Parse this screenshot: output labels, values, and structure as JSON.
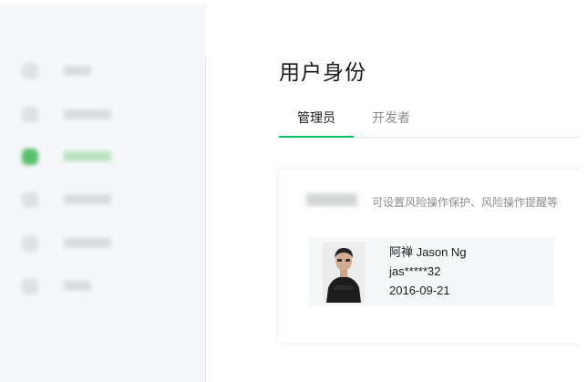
{
  "main": {
    "title": "用户身份",
    "tabs": [
      {
        "label": "管理员",
        "active": true
      },
      {
        "label": "开发者",
        "active": false
      }
    ],
    "description": "可设置风险操作保护、风险操作提醒等",
    "user": {
      "name": "阿禅 Jason Ng",
      "account": "jas*****32",
      "date": "2016-09-21"
    }
  },
  "sidebar": {
    "item_count": 6,
    "active_index": 2
  },
  "colors": {
    "accent": "#07c160",
    "sidebar_active_icon": "#58be6a",
    "background": "#f6f7f9"
  }
}
